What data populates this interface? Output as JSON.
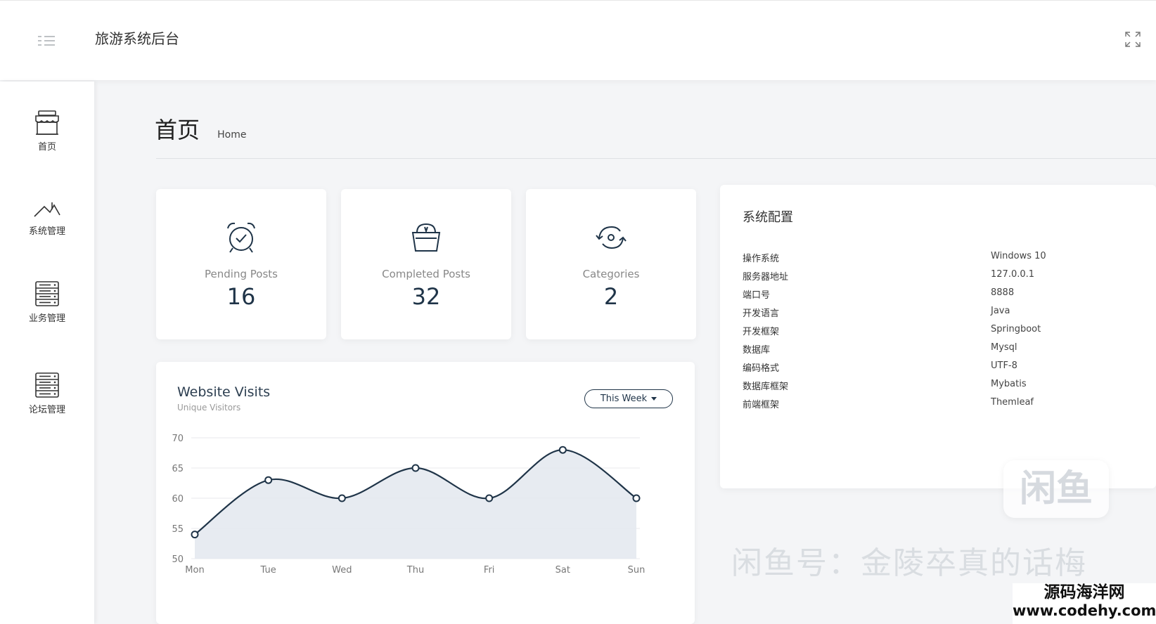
{
  "header": {
    "app_title": "旅游系统后台"
  },
  "sidebar": {
    "items": [
      {
        "label": "首页",
        "icon": "store-icon"
      },
      {
        "label": "系统管理",
        "icon": "chart-line-icon"
      },
      {
        "label": "业务管理",
        "icon": "server-icon"
      },
      {
        "label": "论坛管理",
        "icon": "server-icon"
      }
    ]
  },
  "page": {
    "title": "首页",
    "subtitle": "Home"
  },
  "stats": [
    {
      "label": "Pending Posts",
      "value": "16",
      "icon": "alarm-clock-icon"
    },
    {
      "label": "Completed Posts",
      "value": "32",
      "icon": "basket-icon"
    },
    {
      "label": "Categories",
      "value": "2",
      "icon": "refresh-icon"
    }
  ],
  "config": {
    "title": "系统配置",
    "rows": [
      {
        "key": "操作系统",
        "value": "Windows 10"
      },
      {
        "key": "服务器地址",
        "value": "127.0.0.1"
      },
      {
        "key": "端口号",
        "value": "8888"
      },
      {
        "key": "开发语言",
        "value": "Java"
      },
      {
        "key": "开发框架",
        "value": "Springboot"
      },
      {
        "key": "数据库",
        "value": "Mysql"
      },
      {
        "key": "编码格式",
        "value": "UTF-8"
      },
      {
        "key": "数据库框架",
        "value": "Mybatis"
      },
      {
        "key": "前端框架",
        "value": "Themleaf"
      }
    ]
  },
  "visits": {
    "title": "Website Visits",
    "subtitle": "Unique Visitors",
    "range_button": "This Week"
  },
  "chart_data": {
    "type": "area",
    "title": "Website Visits",
    "subtitle": "Unique Visitors",
    "categories": [
      "Mon",
      "Tue",
      "Wed",
      "Thu",
      "Fri",
      "Sat",
      "Sun"
    ],
    "values": [
      54,
      63,
      60,
      65,
      60,
      68,
      60
    ],
    "yticks": [
      50,
      55,
      60,
      65,
      70
    ],
    "ylim": [
      50,
      70
    ],
    "grid": true,
    "line_color": "#1f3448",
    "fill_color": "#e3e7ee"
  },
  "watermark": {
    "logo_text": "闲鱼",
    "caption": "闲鱼号：金陵卒真的话梅",
    "site_line1": "源码海洋网",
    "site_line2": "www.codehy.com"
  }
}
